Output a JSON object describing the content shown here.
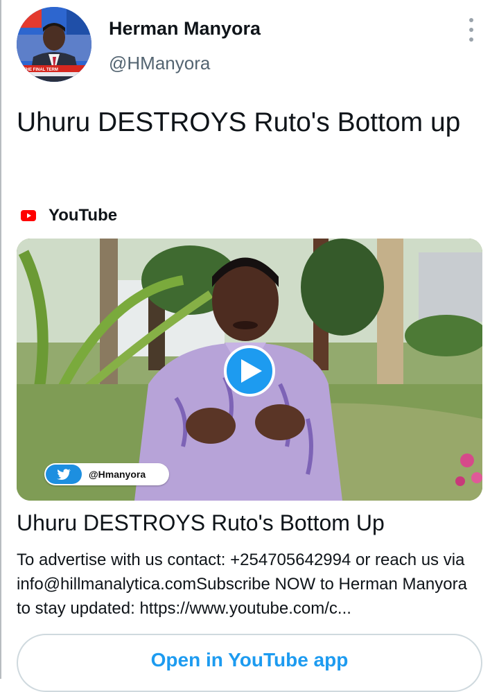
{
  "author": {
    "name": "Herman Manyora",
    "handle": "@HManyora",
    "avatar_banner_text": "THE FINAL TERM"
  },
  "tweet": {
    "text": "Uhuru DESTROYS Ruto's Bottom up"
  },
  "card": {
    "source": "YouTube",
    "video_overlay_handle": "@Hmanyora",
    "title": "Uhuru DESTROYS Ruto's Bottom Up",
    "description": "To advertise with us contact: +254705642994 or reach us via info@hillmanalytica.comSubscribe NOW to Herman Manyora to stay updated: https://www.youtube.com/c...",
    "open_button_label": "Open in YouTube app"
  },
  "icons": {
    "more": "more-vertical-icon",
    "source": "youtube-logo-icon",
    "play": "play-icon",
    "overlay": "twitter-bird-icon"
  },
  "colors": {
    "accent": "#1d9bf0",
    "youtube_red": "#ff0000",
    "secondary_text": "#536471"
  }
}
